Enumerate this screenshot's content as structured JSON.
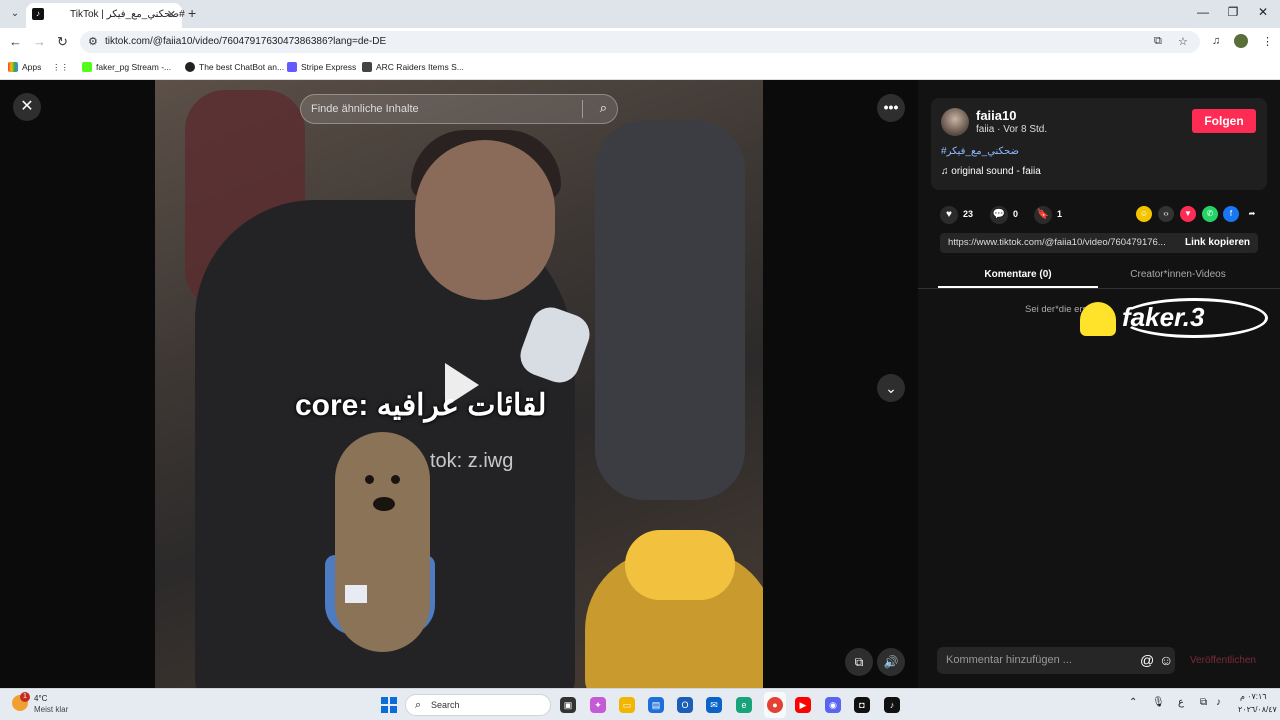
{
  "browser": {
    "tab_title": "TikTok | ضحكني_مع_فيكر#",
    "tab_favicon": "tiktok-icon",
    "url": "tiktok.com/@faiia10/video/7604791763047386386?lang=de-DE",
    "bookmarks": [
      {
        "label": "Apps",
        "icon": "apps-grid-icon"
      },
      {
        "label": "faker_pg Stream -...",
        "icon": "kick-icon",
        "color": "#53fc18"
      },
      {
        "label": "The best ChatBot an...",
        "icon": "chatgpt-icon",
        "color": "#222222"
      },
      {
        "label": "Stripe Express",
        "icon": "stripe-icon",
        "color": "#635bff"
      },
      {
        "label": "ARC Raiders Items S...",
        "icon": "arc-raiders-icon",
        "color": "#444444"
      }
    ]
  },
  "video": {
    "search_placeholder": "Finde ähnliche Inhalte",
    "caption": "core: لقائات عرافيه",
    "watermark": "tok: z.iwg"
  },
  "author": {
    "username": "faiia10",
    "meta": "faiia · Vor 8 Std.",
    "follow_label": "Folgen",
    "hashtag": "#ضحكني_مع_فيكر",
    "sound": "original sound - faiia"
  },
  "actions": {
    "likes": "23",
    "comments": "0",
    "saves": "1"
  },
  "share": {
    "link": "https://www.tiktok.com/@faiia10/video/760479176...",
    "copy_label": "Link kopieren"
  },
  "tabs": {
    "comments": "Komentare (0)",
    "creator_videos": "Creator*innen-Videos"
  },
  "comments_empty": "Sei der*die ers",
  "overlay_logo": "faker.3",
  "comment_box": {
    "placeholder": "Kommentar hinzufügen ...",
    "publish_label": "Veröffentlichen"
  },
  "taskbar": {
    "weather_temp": "4°C",
    "weather_desc": "Meist klar",
    "weather_badge": "1",
    "search_label": "Search",
    "lang": "ع",
    "time": "٠٧:١٦ م",
    "date": "٢٠٢٦/٠٨/٤٧"
  },
  "colors": {
    "accent": "#fe2c55",
    "hashtag": "#8fb8ff"
  }
}
